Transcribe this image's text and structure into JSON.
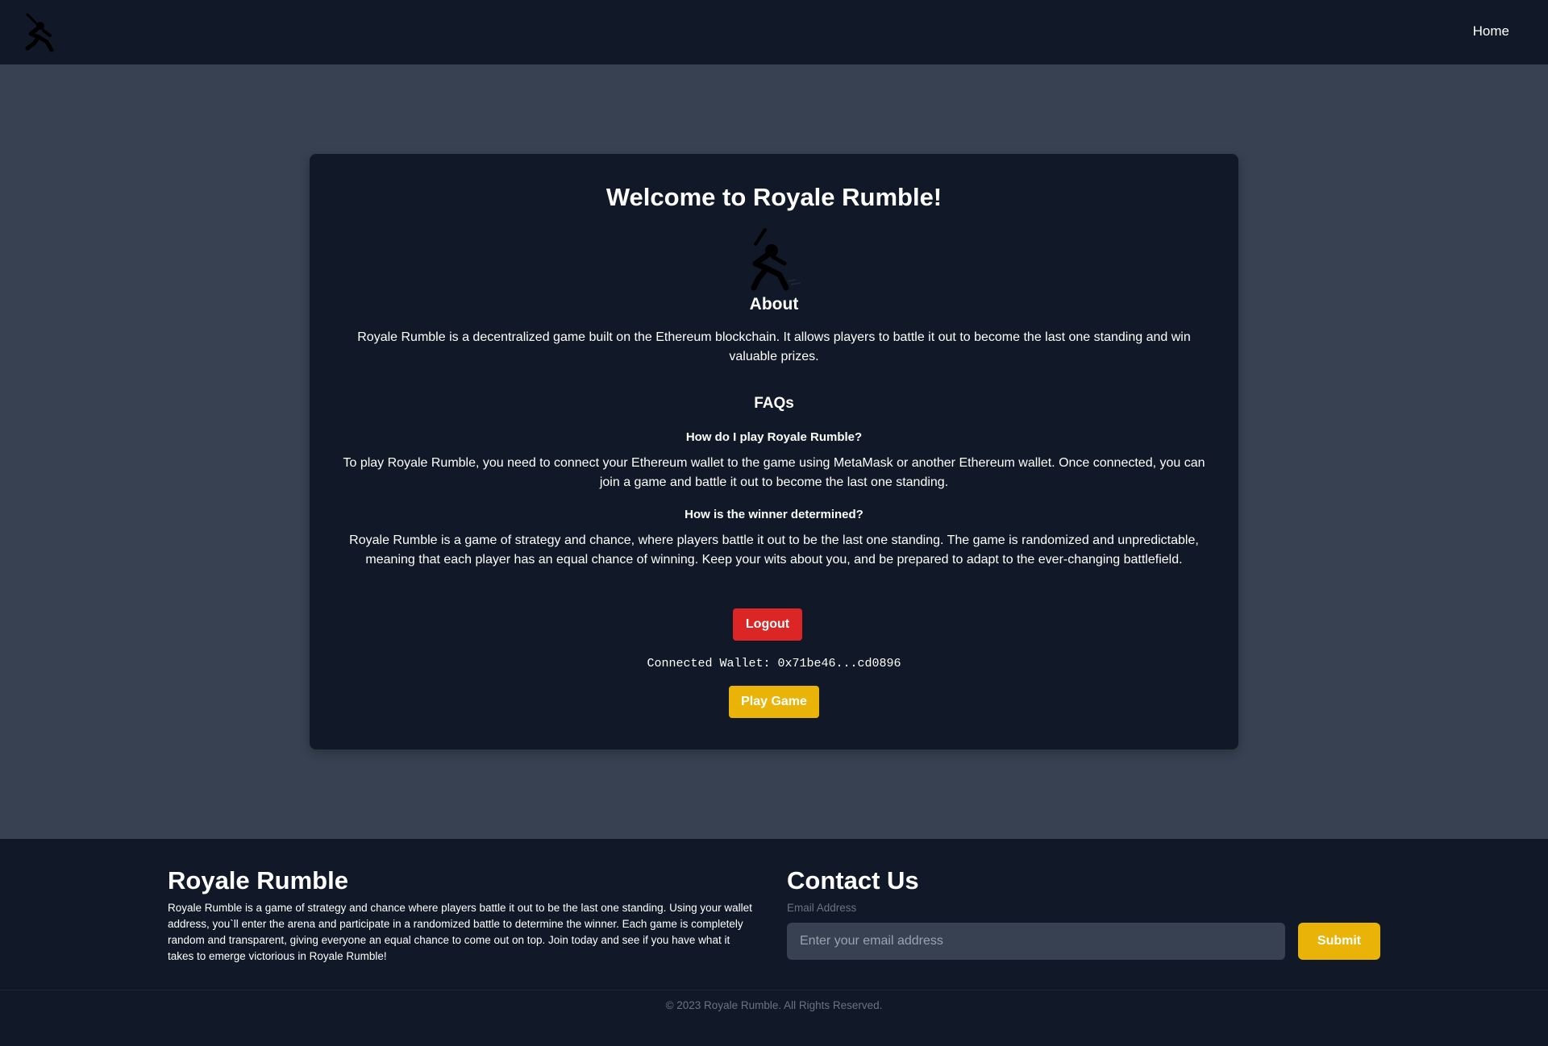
{
  "header": {
    "logo_icon": "warrior-silhouette-icon",
    "nav": {
      "home_label": "Home"
    }
  },
  "main": {
    "title": "Welcome to Royale Rumble!",
    "hero_icon": "warrior-silhouette-icon",
    "about": {
      "heading": "About",
      "text": "Royale Rumble is a decentralized game built on the Ethereum blockchain. It allows players to battle it out to become the last one standing and win valuable prizes."
    },
    "faqs": {
      "heading": "FAQs",
      "items": [
        {
          "question": "How do I play Royale Rumble?",
          "answer": "To play Royale Rumble, you need to connect your Ethereum wallet to the game using MetaMask or another Ethereum wallet. Once connected, you can join a game and battle it out to become the last one standing."
        },
        {
          "question": "How is the winner determined?",
          "answer": "Royale Rumble is a game of strategy and chance, where players battle it out to be the last one standing. The game is randomized and unpredictable, meaning that each player has an equal chance of winning. Keep your wits about you, and be prepared to adapt to the ever-changing battlefield."
        }
      ]
    },
    "logout_label": "Logout",
    "wallet_text": "Connected Wallet: 0x71be46...cd0896",
    "play_label": "Play Game"
  },
  "footer": {
    "brand": {
      "title": "Royale Rumble",
      "text": "Royale Rumble is a game of strategy and chance where players battle it out to be the last one standing. Using your wallet address, you`ll enter the arena and participate in a randomized battle to determine the winner. Each game is completely random and transparent, giving everyone an equal chance to come out on top. Join today and see if you have what it takes to emerge victorious in Royale Rumble!"
    },
    "contact": {
      "title": "Contact Us",
      "email_label": "Email Address",
      "email_placeholder": "Enter your email address",
      "email_value": "",
      "submit_label": "Submit"
    },
    "copyright": "© 2023 Royale Rumble. All Rights Reserved."
  },
  "colors": {
    "page_bg": "#374151",
    "panel_bg": "#111827",
    "logout": "#dc2626",
    "accent": "#eab308",
    "muted_text": "#6b7280"
  }
}
